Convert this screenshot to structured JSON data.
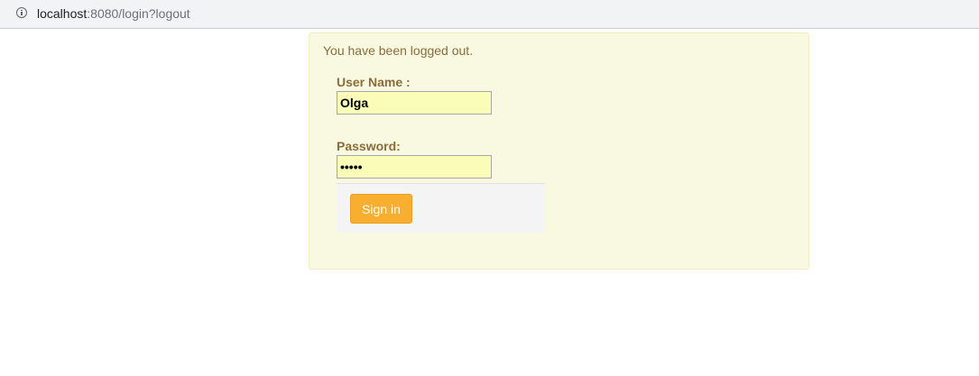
{
  "browser": {
    "url_host": "localhost",
    "url_rest": ":8080/login?logout",
    "icon": "info-icon"
  },
  "login": {
    "message": "You have been logged out.",
    "username_label": "User Name :",
    "username_value": "Olga",
    "password_label": "Password:",
    "password_value": "•••••",
    "signin_label": "Sign in"
  },
  "colors": {
    "panel_bg": "#f9f8e0",
    "label_text": "#8a6d3b",
    "input_bg": "#fafdb8",
    "button_bg": "#f8ae2e"
  }
}
